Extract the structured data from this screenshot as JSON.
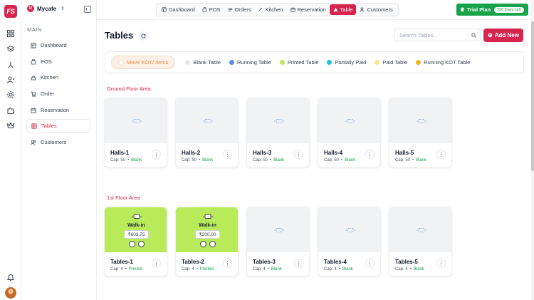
{
  "rail": {
    "logo": "FS",
    "icons": [
      "grid-icon",
      "layers-icon",
      "merge-icon",
      "users-icon",
      "settings-icon",
      "puzzle-icon",
      "crown-icon"
    ],
    "bottom_icons": [
      "bell-icon"
    ]
  },
  "sidebar": {
    "brand": "Mycafe",
    "brand_badge": "M",
    "section": "MAIN",
    "items": [
      {
        "label": "Dashboard",
        "icon": "layout-icon"
      },
      {
        "label": "POS",
        "icon": "pos-icon"
      },
      {
        "label": "Kitchen",
        "icon": "kitchen-icon"
      },
      {
        "label": "Order",
        "icon": "cart-icon"
      },
      {
        "label": "Reservation",
        "icon": "calendar-icon"
      },
      {
        "label": "Tables",
        "icon": "table-icon",
        "active": true
      },
      {
        "label": "Customers",
        "icon": "customers-icon"
      }
    ]
  },
  "topbar": {
    "tabs": [
      {
        "label": "Dashboard",
        "icon": "layout-icon"
      },
      {
        "label": "POS",
        "icon": "pos-icon"
      },
      {
        "label": "Orders",
        "icon": "orders-icon"
      },
      {
        "label": "Kitchen",
        "icon": "kitchen-icon"
      },
      {
        "label": "Reservation",
        "icon": "calendar-icon"
      },
      {
        "label": "Table",
        "icon": "table-icon",
        "active": true
      },
      {
        "label": "Customers",
        "icon": "customers-icon"
      }
    ],
    "trial_label": "Trial Plan",
    "trial_days": "290 Days Left"
  },
  "main": {
    "title": "Tables",
    "search_placeholder": "Search Tables...",
    "add_new": "Add New",
    "move_kot": "Move KOT/ Items",
    "legend": [
      {
        "label": "Blank Table",
        "color": "#e5e7eb"
      },
      {
        "label": "Running Table",
        "color": "#5b8def"
      },
      {
        "label": "Printed Table",
        "color": "#b9ea5a"
      },
      {
        "label": "Partially Paid",
        "color": "#22c1dc"
      },
      {
        "label": "Paid Table",
        "color": "#fde68a"
      },
      {
        "label": "Running KOT Table",
        "color": "#f5b418"
      }
    ],
    "areas": [
      {
        "name": "Ground Floor Area",
        "tables": [
          {
            "name": "Halls-1",
            "cap": "Cap: 50",
            "status": "Blank"
          },
          {
            "name": "Halls-2",
            "cap": "Cap: 50",
            "status": "Blank"
          },
          {
            "name": "Halls-3",
            "cap": "Cap: 50",
            "status": "Blank"
          },
          {
            "name": "Halls-4",
            "cap": "Cap: 50",
            "status": "Blank"
          },
          {
            "name": "Halls-5",
            "cap": "Cap: 50",
            "status": "Blank"
          }
        ]
      },
      {
        "name": "1st Floor Area",
        "tables": [
          {
            "name": "Tables-1",
            "cap": "Cap: 4",
            "status": "Printed",
            "customer": "Walk-in",
            "amount": "₹603.75"
          },
          {
            "name": "Tables-2",
            "cap": "Cap: 4",
            "status": "Printed",
            "customer": "Walk-in",
            "amount": "₹200.00"
          },
          {
            "name": "Tables-3",
            "cap": "Cap: 4",
            "status": "Blank"
          },
          {
            "name": "Tables-4",
            "cap": "Cap: 4",
            "status": "Blank"
          },
          {
            "name": "Tables-5",
            "cap": "Cap: 4",
            "status": "Blank"
          }
        ]
      }
    ]
  }
}
